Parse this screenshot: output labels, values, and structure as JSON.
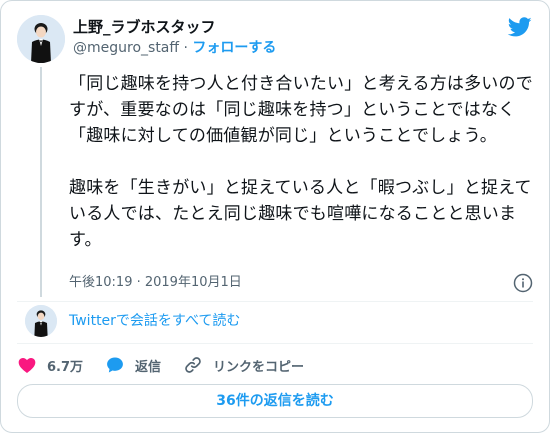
{
  "user": {
    "display_name": "上野_ラブホスタッフ",
    "handle": "@meguro_staff",
    "separator": " · ",
    "follow_label": "フォローする"
  },
  "tweet": {
    "text": "「同じ趣味を持つ人と付き合いたい」と考える方は多いのですが、重要なのは「同じ趣味を持つ」ということではなく「趣味に対しての価値観が同じ」ということでしょう。\n\n趣味を「生きがい」と捉えている人と「暇つぶし」と捉えている人では、たとえ同じ趣味でも喧嘩になることと思います。",
    "timestamp": "午後10:19 · 2019年10月1日"
  },
  "conversation": {
    "read_label": "Twitterで会話をすべて読む"
  },
  "actions": {
    "like_count": "6.7万",
    "reply_label": "返信",
    "copy_link_label": "リンクをコピー"
  },
  "replies": {
    "read_replies_label": "36件の返信を読む"
  },
  "colors": {
    "accent": "#1d9bf0",
    "like": "#f91880",
    "text": "#0f1419",
    "muted": "#536471",
    "border": "#cfd9de"
  },
  "icons": {
    "brand": "twitter-bird-icon",
    "info": "info-icon",
    "like": "heart-icon",
    "reply": "speech-bubble-icon",
    "copy_link": "link-icon"
  }
}
